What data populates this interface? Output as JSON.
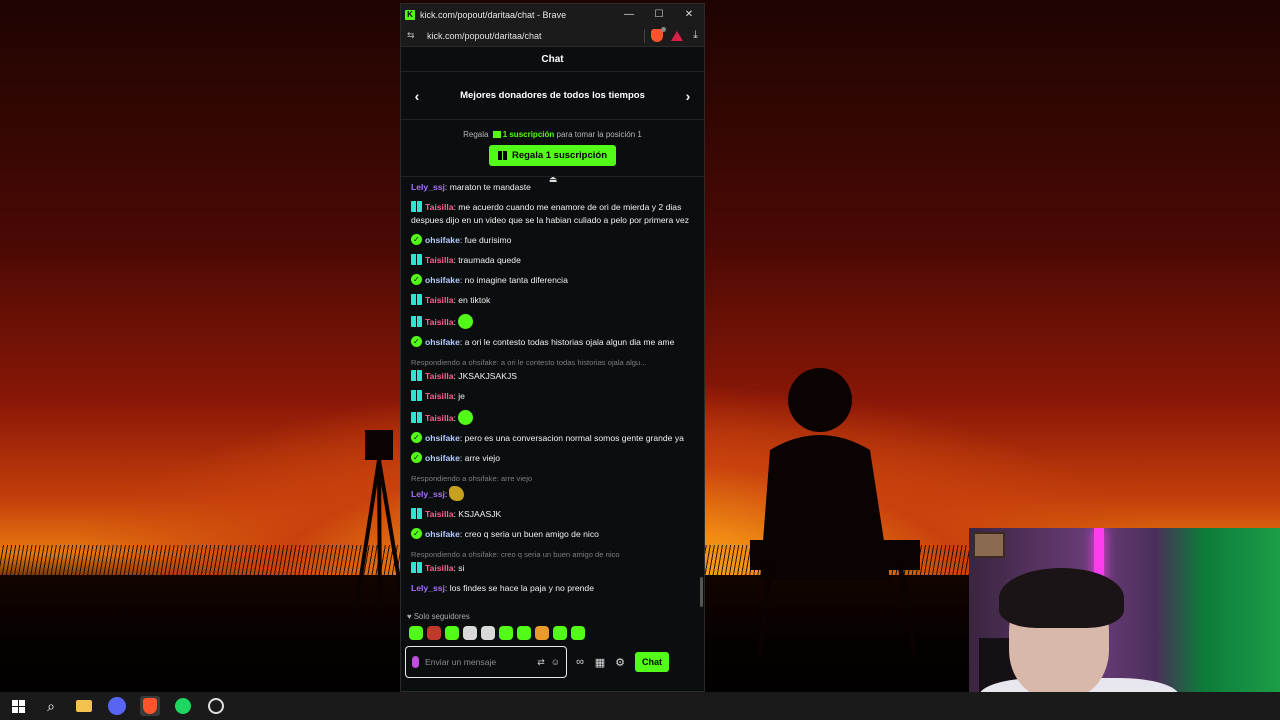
{
  "window": {
    "title": "kick.com/popout/daritaa/chat - Brave",
    "controls": {
      "minimize": "—",
      "maximize": "☐",
      "close": "✕"
    }
  },
  "address_bar": {
    "url": "kick.com/popout/daritaa/chat"
  },
  "chat": {
    "header": "Chat",
    "leaderboard_title": "Mejores donadores de todos los tiempos",
    "gift_prefix": "Regala",
    "gift_highlight": "1 suscripción",
    "gift_suffix": "para tomar la posición 1",
    "gift_button": "Regala 1 suscripción",
    "messages": [
      {
        "user": "Lely_ssj",
        "badge": "none",
        "text": ": maraton te mandaste"
      },
      {
        "user": "Taisilla",
        "badge": "tai",
        "text": ": me acuerdo cuando me enamore de ori de mierda y 2 dias despues dijo en un video que se la habian culiado a pelo por primera vez"
      },
      {
        "user": "ohsifake",
        "badge": "ohs",
        "text": ": fue durisimo"
      },
      {
        "user": "Taisilla",
        "badge": "tai",
        "text": ": traumada quede"
      },
      {
        "user": "ohsifake",
        "badge": "ohs",
        "text": ": no imagine tanta diferencia"
      },
      {
        "user": "Taisilla",
        "badge": "tai",
        "text": ": en tiktok"
      },
      {
        "user": "Taisilla",
        "badge": "tai",
        "text": ":",
        "emote": "green"
      },
      {
        "user": "ohsifake",
        "badge": "ohs",
        "text": ": a ori le contesto todas historias ojala algun dia me ame"
      },
      {
        "reply": "Respondiendo a ohsifake: a ori le contesto todas historias ojala algu...",
        "user": "Taisilla",
        "badge": "tai",
        "text": ": JKSAKJSAKJS"
      },
      {
        "user": "Taisilla",
        "badge": "tai",
        "text": ": je"
      },
      {
        "user": "Taisilla",
        "badge": "tai",
        "text": ":",
        "emote": "green"
      },
      {
        "user": "ohsifake",
        "badge": "ohs",
        "text": ": pero es una conversacion normal somos gente grande ya"
      },
      {
        "user": "ohsifake",
        "badge": "ohs",
        "text": ": arre viejo"
      },
      {
        "reply": "Respondiendo a ohsifake: arre viejo",
        "user": "Lely_ssj",
        "badge": "none",
        "text": ":",
        "emote": "gold"
      },
      {
        "user": "Taisilla",
        "badge": "tai",
        "text": ": KSJAASJK"
      },
      {
        "user": "ohsifake",
        "badge": "ohs",
        "text": ": creo q seria un buen amigo de nico"
      },
      {
        "reply": "Respondiendo a ohsifake: creo q seria un buen amigo de nico",
        "user": "Taisilla",
        "badge": "tai",
        "text": ": si"
      },
      {
        "user": "Lely_ssj",
        "badge": "none",
        "text": ": los findes se hace la paja y no prende"
      }
    ],
    "followers_only": "Solo seguidores",
    "input_placeholder": "Enviar un mensaje",
    "send_button": "Chat"
  },
  "icons": {
    "left_arrow": "chevron-left-icon",
    "right_arrow": "chevron-right-icon",
    "mic": "mic-icon",
    "translate": "translate-icon",
    "emoji": "emoji-icon",
    "settings": "gear-icon",
    "store": "store-icon"
  },
  "colors": {
    "kick_green": "#53fc18",
    "lely": "#a970ff",
    "taisilla": "#ff5d8f",
    "ohsifake": "#b7ccff"
  }
}
